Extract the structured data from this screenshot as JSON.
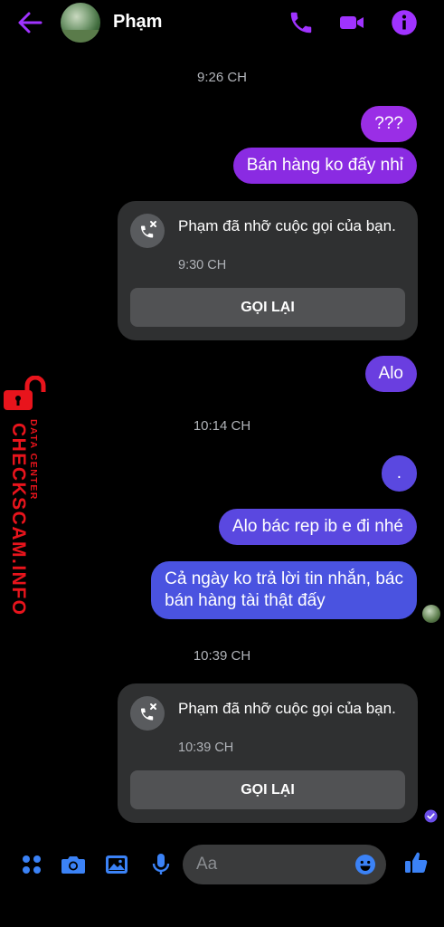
{
  "header": {
    "contact_name": "Phạm",
    "icons": [
      "back-arrow-icon",
      "phone-icon",
      "video-icon",
      "info-icon"
    ]
  },
  "messages": {
    "ts1": "9:26 CH",
    "m1": "???",
    "m2": "Bán hàng ko đấy nhỉ",
    "call1": {
      "text": "Phạm đã nhỡ cuộc gọi của bạn.",
      "time": "9:30 CH",
      "button": "GỌI LẠI"
    },
    "m3": "Alo",
    "ts2": "10:14 CH",
    "m4": ".",
    "m5": "Alo bác rep ib e đi nhé",
    "m6_line1": "Cả ngày ko trả lời tin nhắn, bác",
    "m6_line2": "bán hàng tài thật đấy",
    "ts3": "10:39 CH",
    "call2": {
      "text": "Phạm đã nhỡ cuộc gọi của bạn.",
      "time": "10:39 CH",
      "button": "GỌI LẠI"
    }
  },
  "composer": {
    "placeholder": "Aa",
    "icons": [
      "menu-dots-icon",
      "camera-icon",
      "gallery-icon",
      "microphone-icon",
      "emoji-icon",
      "like-icon"
    ]
  },
  "watermark": {
    "brand": "CHECKSCAM.INFO",
    "tagline": "DATA CENTER"
  },
  "colors": {
    "accent_purple": "#a033ff",
    "bubble_purple": "#8a2be2",
    "bubble_blue": "#4a53e0",
    "card_bg": "#2f3031",
    "watermark_red": "#e8141c"
  }
}
